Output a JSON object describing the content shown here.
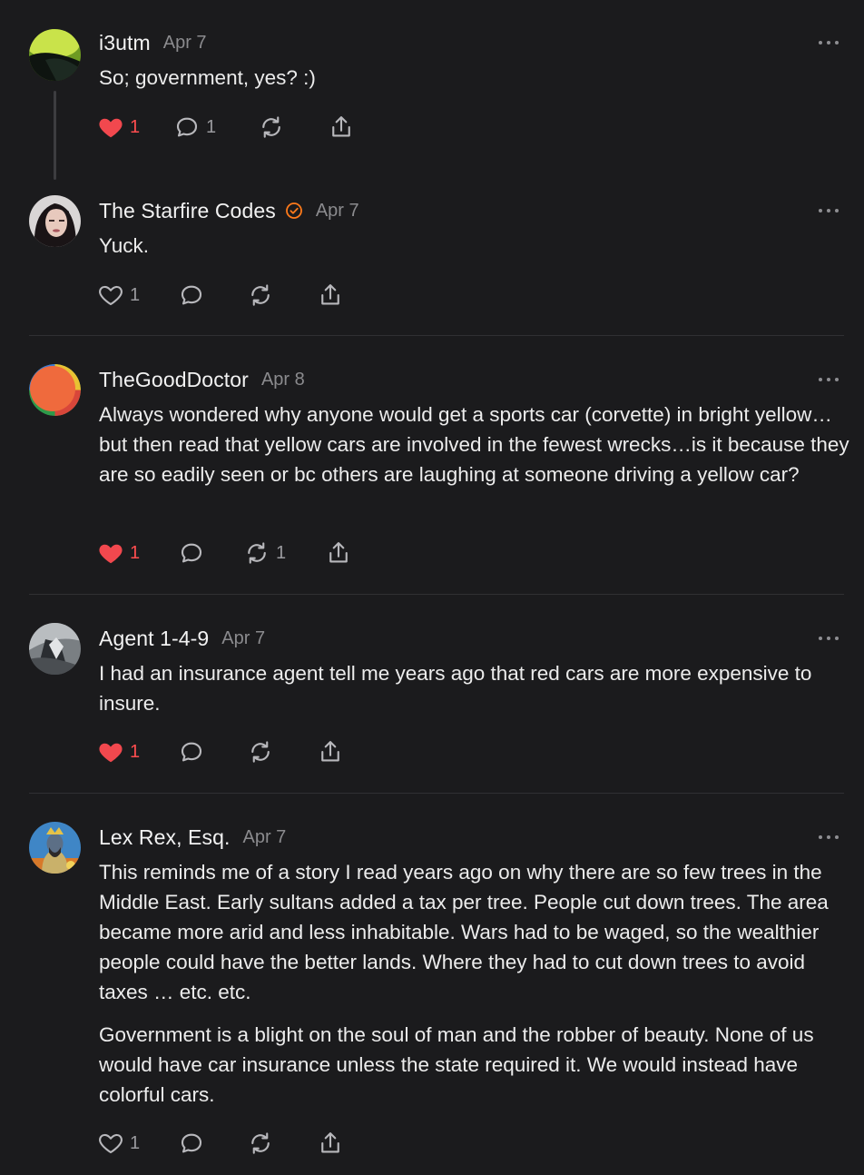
{
  "colors": {
    "background": "#1b1b1d",
    "text": "#ececec",
    "muted": "#8b8b8e",
    "like_active": "#f2484e",
    "verified_badge": "#ff7a1a"
  },
  "comments": [
    {
      "author": "i3utm",
      "date": "Apr 7",
      "verified": false,
      "paragraphs": [
        "So; government, yes? :)"
      ],
      "likes": "1",
      "liked": true,
      "replies": "1",
      "restacks": ""
    },
    {
      "author": "The Starfire Codes",
      "date": "Apr 7",
      "verified": true,
      "paragraphs": [
        "Yuck."
      ],
      "likes": "1",
      "liked": false,
      "replies": "",
      "restacks": ""
    },
    {
      "author": "TheGoodDoctor",
      "date": "Apr 8",
      "verified": false,
      "paragraphs": [
        "Always wondered why anyone would get a sports car (corvette) in bright yellow…but then read that yellow cars are involved in the fewest wrecks…is it because they are so eadily seen or bc others are laughing at someone driving a yellow car?"
      ],
      "likes": "1",
      "liked": true,
      "replies": "",
      "restacks": "1"
    },
    {
      "author": "Agent 1-4-9",
      "date": "Apr 7",
      "verified": false,
      "paragraphs": [
        "I had an insurance agent tell me years ago that red cars are more expensive to insure."
      ],
      "likes": "1",
      "liked": true,
      "replies": "",
      "restacks": ""
    },
    {
      "author": "Lex Rex, Esq.",
      "date": "Apr 7",
      "verified": false,
      "paragraphs": [
        "This reminds me of a story I read years ago on why there are so few trees in the Middle East. Early sultans added a tax per tree. People cut down trees. The area became more arid and less inhabitable. Wars had to be waged, so the wealthier people could have the better lands. Where they had to cut down trees to avoid taxes … etc. etc.",
        "Government is a blight on the soul of man and the robber of beauty. None of us would have car insurance unless the state required it. We would instead have colorful cars."
      ],
      "likes": "1",
      "liked": false,
      "replies": "",
      "restacks": ""
    }
  ]
}
